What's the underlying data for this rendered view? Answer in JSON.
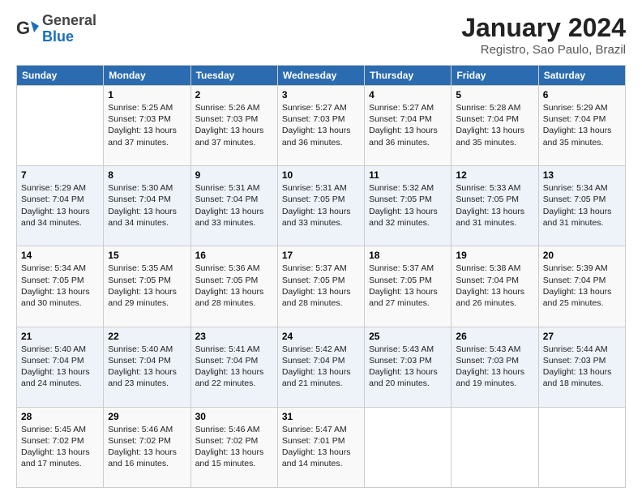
{
  "header": {
    "logo_line1": "General",
    "logo_line2": "Blue",
    "month_title": "January 2024",
    "location": "Registro, Sao Paulo, Brazil"
  },
  "weekdays": [
    "Sunday",
    "Monday",
    "Tuesday",
    "Wednesday",
    "Thursday",
    "Friday",
    "Saturday"
  ],
  "weeks": [
    [
      {
        "num": "",
        "text": ""
      },
      {
        "num": "1",
        "text": "Sunrise: 5:25 AM\nSunset: 7:03 PM\nDaylight: 13 hours\nand 37 minutes."
      },
      {
        "num": "2",
        "text": "Sunrise: 5:26 AM\nSunset: 7:03 PM\nDaylight: 13 hours\nand 37 minutes."
      },
      {
        "num": "3",
        "text": "Sunrise: 5:27 AM\nSunset: 7:03 PM\nDaylight: 13 hours\nand 36 minutes."
      },
      {
        "num": "4",
        "text": "Sunrise: 5:27 AM\nSunset: 7:04 PM\nDaylight: 13 hours\nand 36 minutes."
      },
      {
        "num": "5",
        "text": "Sunrise: 5:28 AM\nSunset: 7:04 PM\nDaylight: 13 hours\nand 35 minutes."
      },
      {
        "num": "6",
        "text": "Sunrise: 5:29 AM\nSunset: 7:04 PM\nDaylight: 13 hours\nand 35 minutes."
      }
    ],
    [
      {
        "num": "7",
        "text": "Sunrise: 5:29 AM\nSunset: 7:04 PM\nDaylight: 13 hours\nand 34 minutes."
      },
      {
        "num": "8",
        "text": "Sunrise: 5:30 AM\nSunset: 7:04 PM\nDaylight: 13 hours\nand 34 minutes."
      },
      {
        "num": "9",
        "text": "Sunrise: 5:31 AM\nSunset: 7:04 PM\nDaylight: 13 hours\nand 33 minutes."
      },
      {
        "num": "10",
        "text": "Sunrise: 5:31 AM\nSunset: 7:05 PM\nDaylight: 13 hours\nand 33 minutes."
      },
      {
        "num": "11",
        "text": "Sunrise: 5:32 AM\nSunset: 7:05 PM\nDaylight: 13 hours\nand 32 minutes."
      },
      {
        "num": "12",
        "text": "Sunrise: 5:33 AM\nSunset: 7:05 PM\nDaylight: 13 hours\nand 31 minutes."
      },
      {
        "num": "13",
        "text": "Sunrise: 5:34 AM\nSunset: 7:05 PM\nDaylight: 13 hours\nand 31 minutes."
      }
    ],
    [
      {
        "num": "14",
        "text": "Sunrise: 5:34 AM\nSunset: 7:05 PM\nDaylight: 13 hours\nand 30 minutes."
      },
      {
        "num": "15",
        "text": "Sunrise: 5:35 AM\nSunset: 7:05 PM\nDaylight: 13 hours\nand 29 minutes."
      },
      {
        "num": "16",
        "text": "Sunrise: 5:36 AM\nSunset: 7:05 PM\nDaylight: 13 hours\nand 28 minutes."
      },
      {
        "num": "17",
        "text": "Sunrise: 5:37 AM\nSunset: 7:05 PM\nDaylight: 13 hours\nand 28 minutes."
      },
      {
        "num": "18",
        "text": "Sunrise: 5:37 AM\nSunset: 7:05 PM\nDaylight: 13 hours\nand 27 minutes."
      },
      {
        "num": "19",
        "text": "Sunrise: 5:38 AM\nSunset: 7:04 PM\nDaylight: 13 hours\nand 26 minutes."
      },
      {
        "num": "20",
        "text": "Sunrise: 5:39 AM\nSunset: 7:04 PM\nDaylight: 13 hours\nand 25 minutes."
      }
    ],
    [
      {
        "num": "21",
        "text": "Sunrise: 5:40 AM\nSunset: 7:04 PM\nDaylight: 13 hours\nand 24 minutes."
      },
      {
        "num": "22",
        "text": "Sunrise: 5:40 AM\nSunset: 7:04 PM\nDaylight: 13 hours\nand 23 minutes."
      },
      {
        "num": "23",
        "text": "Sunrise: 5:41 AM\nSunset: 7:04 PM\nDaylight: 13 hours\nand 22 minutes."
      },
      {
        "num": "24",
        "text": "Sunrise: 5:42 AM\nSunset: 7:04 PM\nDaylight: 13 hours\nand 21 minutes."
      },
      {
        "num": "25",
        "text": "Sunrise: 5:43 AM\nSunset: 7:03 PM\nDaylight: 13 hours\nand 20 minutes."
      },
      {
        "num": "26",
        "text": "Sunrise: 5:43 AM\nSunset: 7:03 PM\nDaylight: 13 hours\nand 19 minutes."
      },
      {
        "num": "27",
        "text": "Sunrise: 5:44 AM\nSunset: 7:03 PM\nDaylight: 13 hours\nand 18 minutes."
      }
    ],
    [
      {
        "num": "28",
        "text": "Sunrise: 5:45 AM\nSunset: 7:02 PM\nDaylight: 13 hours\nand 17 minutes."
      },
      {
        "num": "29",
        "text": "Sunrise: 5:46 AM\nSunset: 7:02 PM\nDaylight: 13 hours\nand 16 minutes."
      },
      {
        "num": "30",
        "text": "Sunrise: 5:46 AM\nSunset: 7:02 PM\nDaylight: 13 hours\nand 15 minutes."
      },
      {
        "num": "31",
        "text": "Sunrise: 5:47 AM\nSunset: 7:01 PM\nDaylight: 13 hours\nand 14 minutes."
      },
      {
        "num": "",
        "text": ""
      },
      {
        "num": "",
        "text": ""
      },
      {
        "num": "",
        "text": ""
      }
    ]
  ]
}
